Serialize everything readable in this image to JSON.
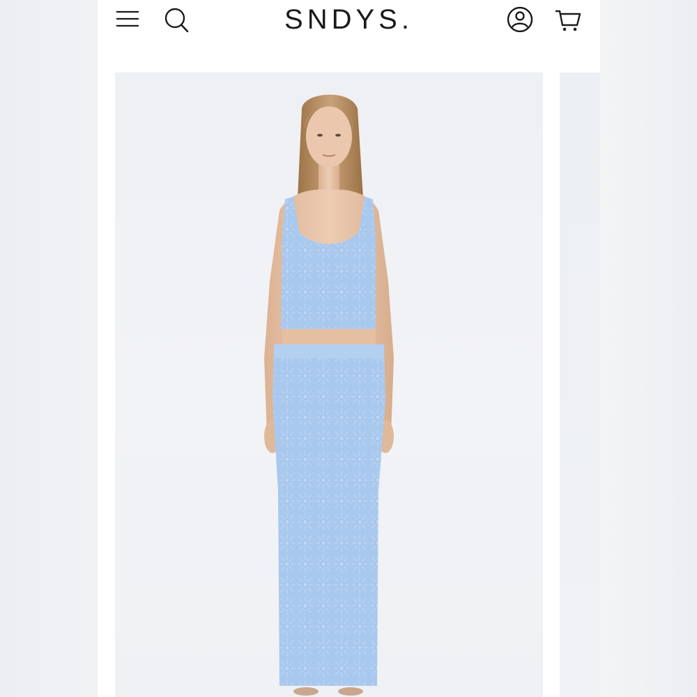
{
  "header": {
    "brand": "SNDYS.",
    "icons": {
      "menu": "hamburger-menu-icon",
      "search": "search-icon",
      "account": "account-icon",
      "cart": "cart-icon"
    }
  },
  "carousel": {
    "main_image": "product-photo-model-light-blue-knit-set",
    "next_image": "product-photo-next"
  },
  "colors": {
    "background": "#ffffff",
    "text": "#1a1a1a",
    "photo_bg": "#f0f2f5",
    "garment": "#a9c8ee",
    "hair": "#b48a5e",
    "skin": "#e7c4a8"
  }
}
